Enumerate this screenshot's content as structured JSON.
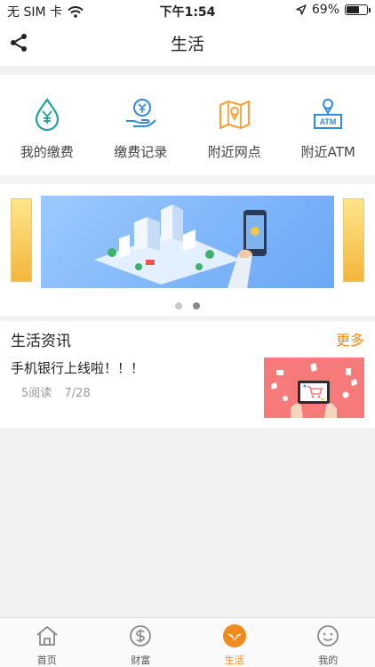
{
  "status_bar": {
    "carrier": "无 SIM 卡",
    "time": "下午1:54",
    "battery": "69%",
    "battery_level": 0.69
  },
  "nav": {
    "title": "生活"
  },
  "quick_actions": [
    {
      "label": "我的缴费",
      "icon": "water-drop-yuan-icon"
    },
    {
      "label": "缴费记录",
      "icon": "hand-yuan-icon"
    },
    {
      "label": "附近网点",
      "icon": "map-pin-icon"
    },
    {
      "label": "附近ATM",
      "icon": "atm-location-icon"
    }
  ],
  "news": {
    "section_title": "生活资讯",
    "more_label": "更多",
    "articles": [
      {
        "title": "手机银行上线啦！！！",
        "reads": "5阅读",
        "date": "7/28"
      }
    ]
  },
  "tabs": [
    {
      "label": "首页",
      "icon": "home-icon",
      "active": false
    },
    {
      "label": "财富",
      "icon": "dollar-coin-icon",
      "active": false
    },
    {
      "label": "生活",
      "icon": "leaf-icon",
      "active": true
    },
    {
      "label": "我的",
      "icon": "smiley-icon",
      "active": false
    }
  ],
  "colors": {
    "accent": "#f08a1e",
    "teal": "#1aa39a",
    "blue": "#2f8be0",
    "orange": "#f3a33a"
  }
}
